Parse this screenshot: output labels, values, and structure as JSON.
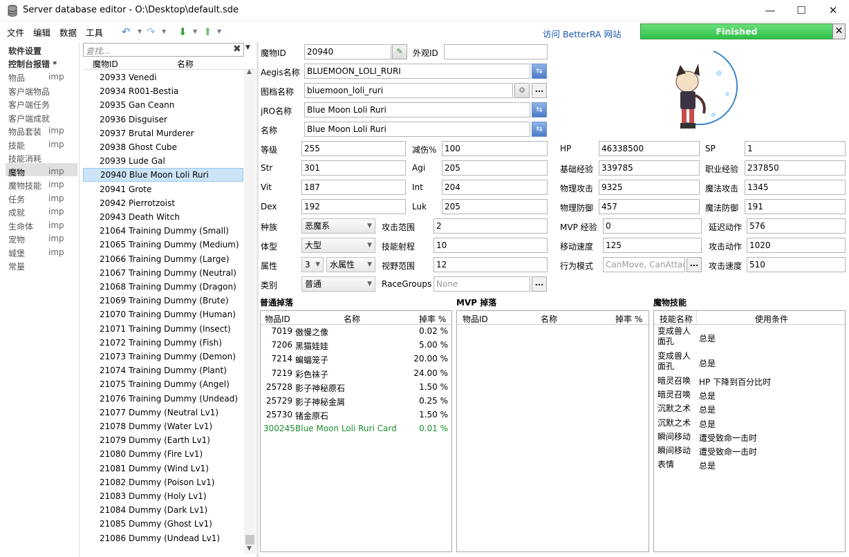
{
  "window": {
    "title": "Server database editor - O:\\Desktop\\default.sde",
    "btn_min": "—",
    "btn_max": "☐",
    "btn_close": "✕"
  },
  "menu": {
    "file": "文件",
    "edit": "编辑",
    "data": "数据",
    "tools": "工具"
  },
  "toolbar": {
    "visit": "访问 BetterRA 网站",
    "progress": "Finished",
    "progress_close": "✕"
  },
  "nav": {
    "settings": "软件设置",
    "console": "控制台报错 *",
    "items": [
      {
        "label": "物品",
        "imp": "imp"
      },
      {
        "label": "客户端物品",
        "imp": ""
      },
      {
        "label": "客户端任务",
        "imp": ""
      },
      {
        "label": "客户端成就",
        "imp": ""
      },
      {
        "label": "物品套装",
        "imp": "imp"
      },
      {
        "label": "技能",
        "imp": "imp"
      },
      {
        "label": "技能消耗",
        "imp": ""
      },
      {
        "label": "魔物",
        "imp": "imp"
      },
      {
        "label": "魔物技能",
        "imp": "imp"
      },
      {
        "label": "任务",
        "imp": "imp"
      },
      {
        "label": "成就",
        "imp": "imp"
      },
      {
        "label": "生命体",
        "imp": "imp"
      },
      {
        "label": "宠物",
        "imp": "imp"
      },
      {
        "label": "城堡",
        "imp": "imp"
      },
      {
        "label": "常量",
        "imp": ""
      }
    ]
  },
  "list": {
    "search_placeholder": "查找...",
    "col_id": "魔物ID",
    "col_name": "名称",
    "rows": [
      "20933 Venedi",
      "20934 R001-Bestia",
      "20935 Gan Ceann",
      "20936 Disguiser",
      "20937 Brutal Murderer",
      "20938 Ghost Cube",
      "20939 Lude Gal",
      "20940 Blue Moon Loli Ruri",
      "20941 Grote",
      "20942 Pierrotzoist",
      "20943 Death Witch",
      "21064 Training Dummy (Small)",
      "21065 Training Dummy (Medium)",
      "21066 Training Dummy (Large)",
      "21067 Training Dummy (Neutral)",
      "21068 Training Dummy (Dragon)",
      "21069 Training Dummy (Brute)",
      "21070 Training Dummy (Human)",
      "21071 Training Dummy (Insect)",
      "21072 Training Dummy (Fish)",
      "21073 Training Dummy (Demon)",
      "21074 Training Dummy (Plant)",
      "21075 Training Dummy (Angel)",
      "21076 Training Dummy (Undead)",
      "21077 Dummy (Neutral Lv1)",
      "21078 Dummy (Water Lv1)",
      "21079 Dummy (Earth Lv1)",
      "21080 Dummy (Fire Lv1)",
      "21081 Dummy (Wind Lv1)",
      "21082 Dummy (Poison Lv1)",
      "21083 Dummy (Holy Lv1)",
      "21084 Dummy (Dark Lv1)",
      "21085 Dummy (Ghost Lv1)",
      "21086 Dummy (Undead Lv1)"
    ]
  },
  "form": {
    "mob_id_label": "魔物ID",
    "mob_id": "20940",
    "view_id_label": "外观ID",
    "view_id": "",
    "aegis_label": "Aegis名称",
    "aegis": "BLUEMOON_LOLI_RURI",
    "sprite_label": "图档名称",
    "sprite": "bluemoon_loli_ruri",
    "jro_label": "jRO名称",
    "jro": "Blue Moon Loli Ruri",
    "name_label": "名称",
    "name": "Blue Moon Loli Ruri",
    "dots": "...",
    "stats": [
      {
        "l": "等级",
        "v": "255"
      },
      {
        "l": "减伤%",
        "v": "100"
      },
      {
        "l": "HP",
        "v": "46338500"
      },
      {
        "l": "SP",
        "v": "1"
      },
      {
        "l": "Str",
        "v": "301"
      },
      {
        "l": "Agi",
        "v": "205"
      },
      {
        "l": "基础经验",
        "v": "339785"
      },
      {
        "l": "职业经验",
        "v": "237850"
      },
      {
        "l": "Vit",
        "v": "187"
      },
      {
        "l": "Int",
        "v": "204"
      },
      {
        "l": "物理攻击",
        "v": "9325"
      },
      {
        "l": "魔法攻击",
        "v": "1345"
      },
      {
        "l": "Dex",
        "v": "192"
      },
      {
        "l": "Luk",
        "v": "205"
      },
      {
        "l": "物理防御",
        "v": "457"
      },
      {
        "l": "魔法防御",
        "v": "191"
      }
    ],
    "race_label": "种族",
    "race": "恶魔系",
    "range_label": "攻击范围",
    "range": "2",
    "mvpexp_label": "MVP 经验",
    "mvpexp": "0",
    "delay_label": "延迟动作",
    "delay": "576",
    "size_label": "体型",
    "size": "大型",
    "skillrange_label": "技能射程",
    "skillrange": "10",
    "speed_label": "移动速度",
    "speed": "125",
    "attackmotion_label": "攻击动作",
    "attackmotion": "1020",
    "element_label": "属性",
    "element_lv": "3",
    "element": "水属性",
    "viewrange_label": "视野范围",
    "viewrange": "12",
    "mode_label": "行为模式",
    "mode": "CanMove, CanAttac",
    "attackspeed_label": "攻击速度",
    "attackspeed": "510",
    "class_label": "类别",
    "class": "普通",
    "racegroups_label": "RaceGroups",
    "racegroups": "None"
  },
  "drops": {
    "title": "普通掉落",
    "col_id": "物品ID",
    "col_name": "名称",
    "col_rate": "掉率 %",
    "rows": [
      {
        "id": "7019",
        "name": "傲慢之像",
        "rate": "0.02 %",
        "card": false
      },
      {
        "id": "7206",
        "name": "黑猫娃娃",
        "rate": "5.00 %",
        "card": false
      },
      {
        "id": "7214",
        "name": "蝙蝠笼子",
        "rate": "20.00 %",
        "card": false
      },
      {
        "id": "7219",
        "name": "彩色袜子",
        "rate": "24.00 %",
        "card": false
      },
      {
        "id": "25728",
        "name": "影子神秘原石",
        "rate": "1.50 %",
        "card": false
      },
      {
        "id": "25729",
        "name": "影子神秘金屑",
        "rate": "0.25 %",
        "card": false
      },
      {
        "id": "25730",
        "name": "锗金原石",
        "rate": "1.50 %",
        "card": false
      },
      {
        "id": "300245",
        "name": "Blue Moon Loli Ruri Card",
        "rate": "0.01 %",
        "card": true
      }
    ]
  },
  "mvpdrops": {
    "title": "MVP 掉落",
    "col_id": "物品ID",
    "col_name": "名称",
    "col_rate": "掉率 %"
  },
  "skills": {
    "title": "魔物技能",
    "col_name": "技能名称",
    "col_cond": "使用条件",
    "rows": [
      {
        "name": "变成兽人面孔",
        "cond": "总是",
        "tall": true
      },
      {
        "name": "变成兽人面孔",
        "cond": "总是",
        "tall": true
      },
      {
        "name": "暗灵召唤",
        "cond": "HP 下降到百分比时",
        "tall": false
      },
      {
        "name": "暗灵召唤",
        "cond": "总是",
        "tall": false
      },
      {
        "name": "沉默之术",
        "cond": "总是",
        "tall": false
      },
      {
        "name": "沉默之术",
        "cond": "总是",
        "tall": false
      },
      {
        "name": "瞬间移动",
        "cond": "遭受致命一击时",
        "tall": false
      },
      {
        "name": "瞬间移动",
        "cond": "遭受致命一击时",
        "tall": false
      },
      {
        "name": "表情",
        "cond": "总是",
        "tall": false
      }
    ]
  }
}
